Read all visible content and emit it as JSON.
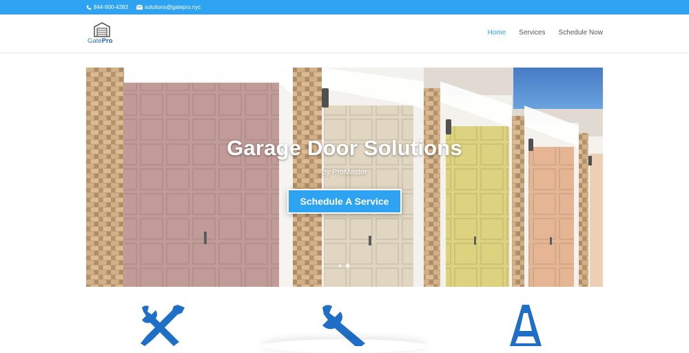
{
  "topbar": {
    "phone": "844-900-4283",
    "email": "solutions@gatepro.nyc",
    "phone_icon": "phone-icon",
    "email_icon": "envelope-icon"
  },
  "logo": {
    "brand_light": "Gate",
    "brand_bold": "Pro",
    "icon": "garage-icon"
  },
  "nav": {
    "items": [
      {
        "label": "Home",
        "active": true
      },
      {
        "label": "Services",
        "active": false
      },
      {
        "label": "Schedule Now",
        "active": false
      }
    ]
  },
  "hero": {
    "title": "Garage Door Solutions",
    "subtitle": "by ProMaster",
    "cta_label": "Schedule A Service",
    "slides": 2,
    "active_slide": 2
  },
  "features": {
    "icons": [
      "tools-icon",
      "wrench-icon",
      "cone-icon"
    ]
  },
  "colors": {
    "accent": "#2ea3f2",
    "icon_blue": "#1f6fc7"
  }
}
